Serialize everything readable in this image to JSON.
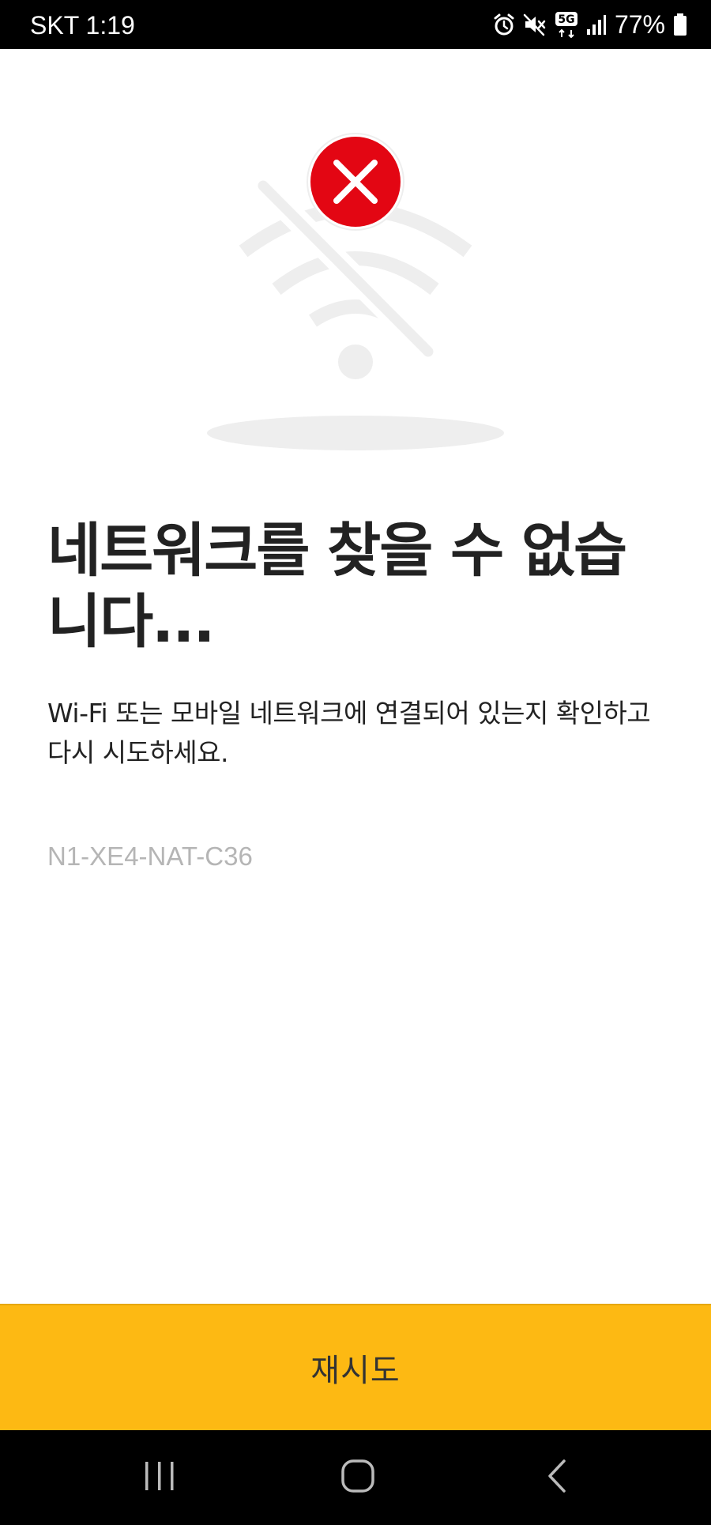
{
  "status_bar": {
    "carrier_time": "SKT 1:19",
    "network_type": "5G",
    "battery": "77%",
    "icons": [
      "alarm-icon",
      "mute-icon",
      "5g-icon",
      "signal-icon",
      "battery-icon"
    ]
  },
  "illustration": {
    "icon": "wifi-off-icon",
    "badge": "error-x-icon",
    "colors": {
      "badge": "#E30613",
      "wifi": "#EEEEEE"
    }
  },
  "content": {
    "headline": "네트워크를 찾을 수 없습니다...",
    "description": "Wi-Fi 또는 모바일 네트워크에 연결되어 있는지 확인하고 다시 시도하세요.",
    "error_code": "N1-XE4-NAT-C36"
  },
  "retry_button": {
    "label": "재시도",
    "color": "#FDB913"
  },
  "nav_bar": {
    "icons": [
      "recent-apps-icon",
      "home-icon",
      "back-icon"
    ]
  }
}
